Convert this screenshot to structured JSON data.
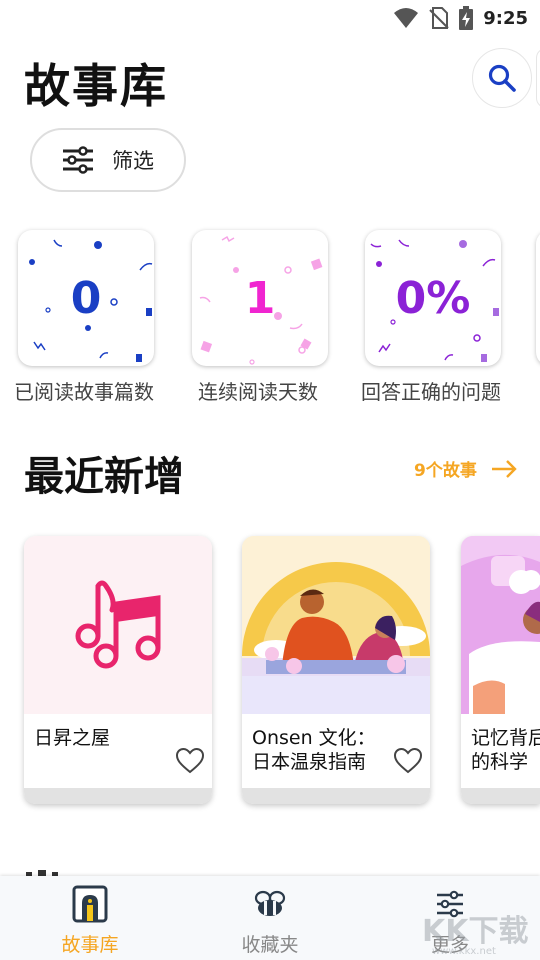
{
  "status_bar": {
    "time": "9:25",
    "icons": [
      "wifi-icon",
      "no-sim-icon",
      "battery-charging-icon"
    ]
  },
  "header": {
    "title": "故事库",
    "search_icon": "search-icon"
  },
  "filter": {
    "label": "筛选",
    "icon": "sliders-icon"
  },
  "stats": [
    {
      "value": "0",
      "label": "已阅读故事篇数",
      "color": "#1a3fc4"
    },
    {
      "value": "1",
      "label": "连续阅读天数",
      "color": "#f025d0"
    },
    {
      "value": "0%",
      "label": "回答正确的问题",
      "color": "#8b22d6"
    }
  ],
  "recent": {
    "title": "最近新增",
    "link_text": "9个故事",
    "accent": "#f5a623",
    "stories": [
      {
        "title": "日昇之屋",
        "image": "music-notes-illustration"
      },
      {
        "title": "Onsen 文化：日本温泉指南",
        "image": "hot-spring-illustration"
      },
      {
        "title": "记忆背后的科学",
        "image": "memory-illustration"
      }
    ]
  },
  "bottom_nav": {
    "items": [
      {
        "label": "故事库",
        "icon": "library-icon",
        "active": true
      },
      {
        "label": "收藏夹",
        "icon": "bee-icon",
        "active": false
      },
      {
        "label": "更多",
        "icon": "sliders-icon",
        "active": false
      }
    ]
  },
  "watermark": {
    "logo": "KK下载",
    "url": "www.kkx.net"
  }
}
